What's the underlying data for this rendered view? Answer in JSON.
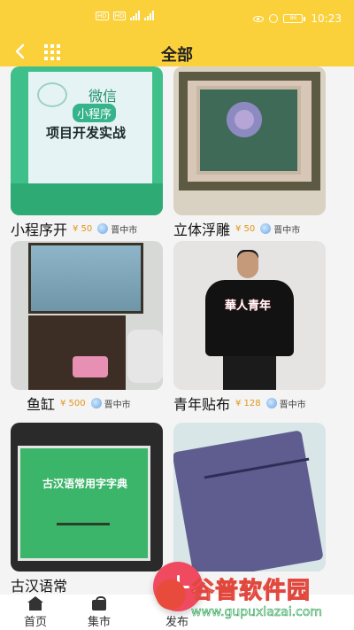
{
  "status_bar": {
    "time": "10:23",
    "battery": "86"
  },
  "nav": {
    "title": "全部"
  },
  "products": [
    {
      "name": "小程序开",
      "price": "¥ 50",
      "location": "晋中市",
      "image_text": {
        "line1": "微信",
        "line2": "小程序",
        "line3": "项目开发实战"
      }
    },
    {
      "name": "立体浮雕",
      "price": "¥ 50",
      "location": "晋中市"
    },
    {
      "name": "鱼缸",
      "price": "¥ 500",
      "location": "晋中市"
    },
    {
      "name": "青年贴布",
      "price": "¥ 128",
      "location": "晋中市",
      "image_text": {
        "print": "華人青年"
      }
    },
    {
      "name": "古汉语常",
      "price": "",
      "location": "",
      "image_text": {
        "title": "古汉语常用字字典"
      }
    },
    {
      "name": "",
      "price": "",
      "location": ""
    }
  ],
  "tabs": [
    {
      "label": "首页",
      "icon": "home-icon"
    },
    {
      "label": "集市",
      "icon": "shopping-bag-icon"
    },
    {
      "label": "发布",
      "icon": "plus-icon"
    }
  ],
  "watermark": {
    "title": "谷普软件园",
    "url": "www.gupuxlazai.com"
  },
  "colors": {
    "header": "#fbd13b",
    "price": "#e2961b",
    "fab": "#ef4a5f"
  }
}
